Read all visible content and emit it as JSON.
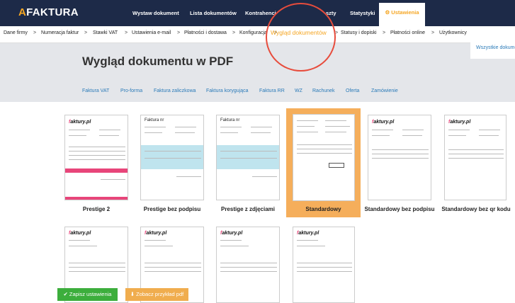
{
  "app": {
    "logo_letter": "A",
    "logo_rest": "FAKTURA"
  },
  "top_nav": {
    "items": [
      "Wystaw dokument",
      "Lista dokumentów",
      "Kontrahenci",
      "szty",
      "Statystyki"
    ],
    "settings": "⚙ Ustawienia"
  },
  "sub_nav": {
    "items": [
      "Dane firmy",
      "Numeracja faktur",
      "Stawki VAT",
      "Ustawienia e-mail",
      "Płatności i dostawa",
      "Konfiguracja",
      "Wygląd dokumentów",
      "Statusy i dopiski",
      "Płatności online",
      "Użytkownicy"
    ],
    "active": "Wygląd dokumentów"
  },
  "page": {
    "title": "Wygląd dokumentu w PDF"
  },
  "doc_tabs": {
    "items": [
      "Faktura VAT",
      "Pro-forma",
      "Faktura zaliczkowa",
      "Faktura korygująca",
      "Faktura RR",
      "WZ",
      "Rachunek",
      "Oferta",
      "Zamówienie"
    ],
    "active": "Wszystkie dokumenty"
  },
  "templates": [
    {
      "label": "Prestige 2"
    },
    {
      "label": "Prestige bez podpisu"
    },
    {
      "label": "Prestige z zdjęciami"
    },
    {
      "label": "Standardowy",
      "selected": true
    },
    {
      "label": "Standardowy bez podpisu"
    },
    {
      "label": "Standardowy bez qr kodu"
    }
  ],
  "thumb_text": {
    "brand_prefix": "f",
    "brand_rest": "aktury.pl",
    "faktura": "Faktura nr"
  },
  "actions": {
    "save": "✔ Zapisz ustawienia",
    "preview": "⬇ Zobacz przykład pdf"
  },
  "colors": {
    "accent": "#f5a623",
    "navy": "#1d2a48",
    "link": "#2a7ab8",
    "pink": "#e8457a",
    "green": "#3cae3c"
  }
}
